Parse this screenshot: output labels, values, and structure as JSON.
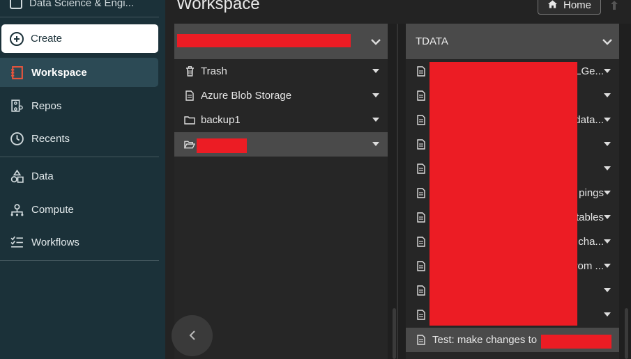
{
  "sidebar": {
    "app_name": "Data Science & Engi...",
    "create_label": "Create",
    "items": [
      {
        "label": "Workspace",
        "icon": "workspace-icon"
      },
      {
        "label": "Repos",
        "icon": "repos-icon"
      },
      {
        "label": "Recents",
        "icon": "clock-icon"
      },
      {
        "label": "Data",
        "icon": "data-icon"
      },
      {
        "label": "Compute",
        "icon": "compute-icon"
      },
      {
        "label": "Workflows",
        "icon": "workflows-icon"
      }
    ]
  },
  "header": {
    "title": "Workspace",
    "home_label": "Home"
  },
  "column1": {
    "items": [
      {
        "label": "Trash",
        "icon": "trash-icon"
      },
      {
        "label": "Azure Blob Storage",
        "icon": "notebook-icon"
      },
      {
        "label": "backup1",
        "icon": "folder-icon"
      },
      {
        "label": "",
        "icon": "folder-open-icon"
      }
    ]
  },
  "column2": {
    "header": "TDATA",
    "items": [
      {
        "suffix": "DLGe..."
      },
      {
        "suffix": ""
      },
      {
        "suffix": ") data..."
      },
      {
        "suffix": ""
      },
      {
        "suffix": ""
      },
      {
        "suffix": "pings"
      },
      {
        "suffix": "tables"
      },
      {
        "suffix": "r cha..."
      },
      {
        "suffix": "from ..."
      },
      {
        "suffix": ""
      },
      {
        "suffix": ""
      }
    ],
    "selected_label": "Test: make changes to"
  },
  "colors": {
    "sidebar_bg": "#1b3139",
    "sidebar_active": "#2c4a55",
    "redaction": "#ec1c24"
  }
}
